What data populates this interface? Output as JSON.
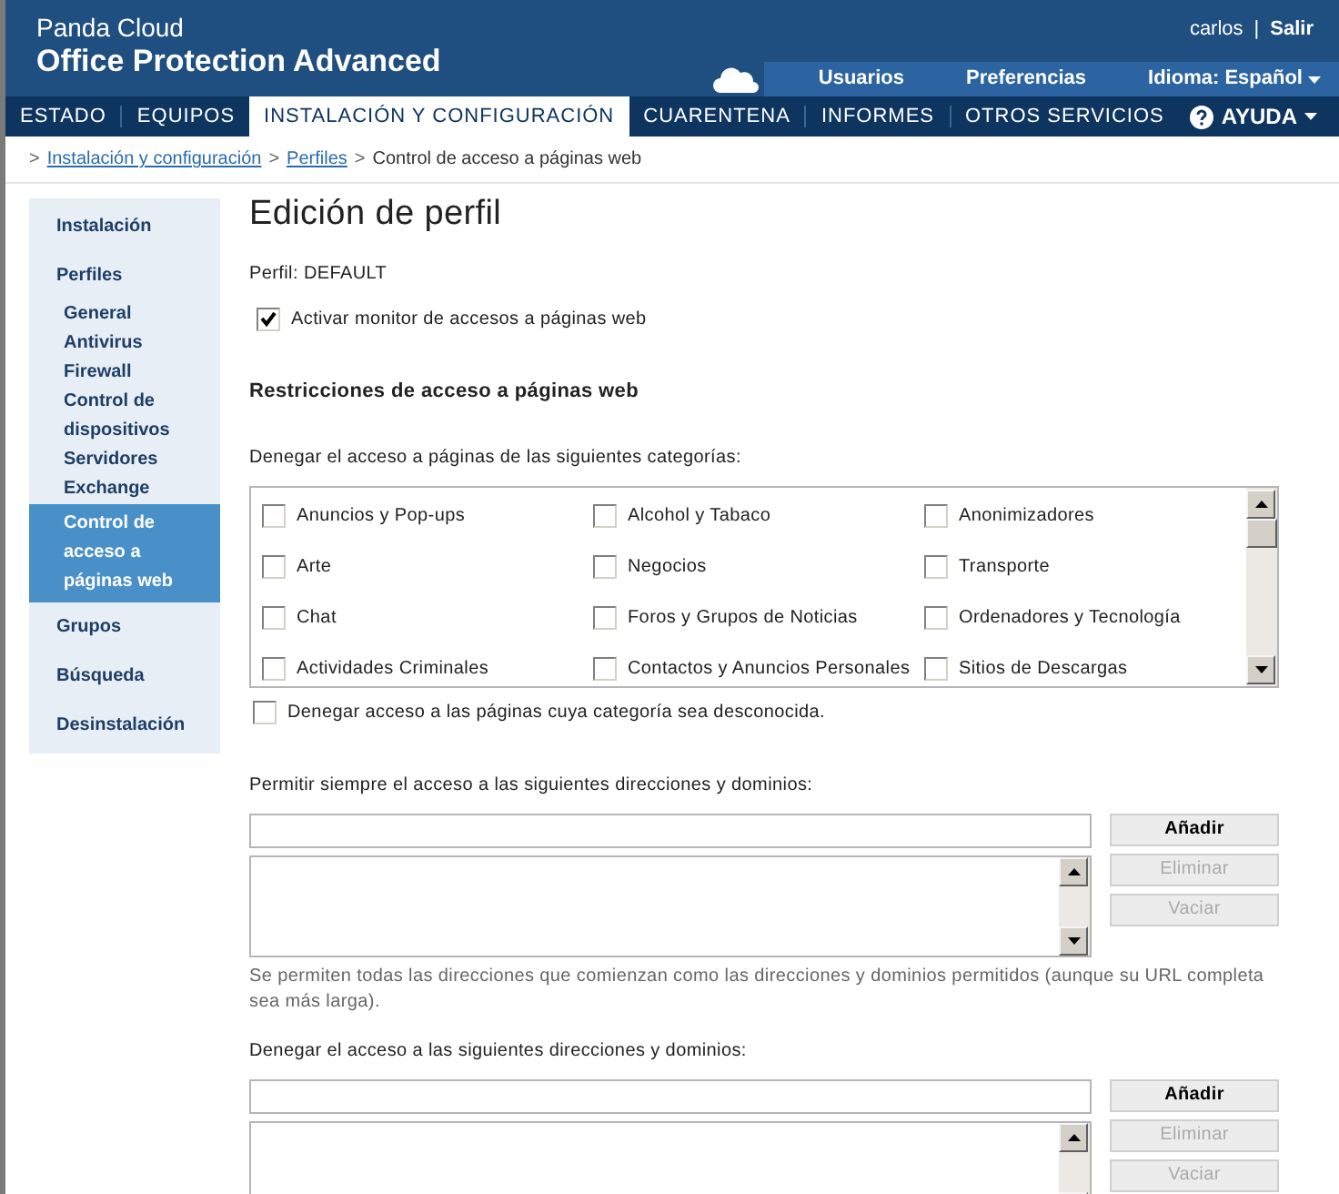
{
  "header": {
    "brand_top": "Panda Cloud",
    "brand_main": "Office Protection Advanced",
    "user": "carlos",
    "separator": "|",
    "logout": "Salir",
    "links": [
      "Usuarios",
      "Preferencias"
    ],
    "language": "Idioma: Español"
  },
  "nav": {
    "tabs": [
      {
        "label": "ESTADO",
        "selected": false
      },
      {
        "label": "EQUIPOS",
        "selected": false
      },
      {
        "label": "INSTALACIÓN Y CONFIGURACIÓN",
        "selected": true
      },
      {
        "label": "CUARENTENA",
        "selected": false
      },
      {
        "label": "INFORMES",
        "selected": false
      },
      {
        "label": "OTROS SERVICIOS",
        "selected": false
      }
    ],
    "help": "AYUDA"
  },
  "breadcrumb": [
    {
      "separator": ">",
      "label": "Instalación y configuración",
      "link": true
    },
    {
      "separator": ">",
      "label": "Perfiles",
      "link": true
    },
    {
      "separator": ">",
      "label": "Control de acceso a páginas web",
      "link": false
    }
  ],
  "sidebar": {
    "items": [
      {
        "label": "Instalación",
        "selected": false
      },
      {
        "label": "Perfiles",
        "selected": false,
        "children": [
          {
            "label": "General",
            "selected": false
          },
          {
            "label": "Antivirus",
            "selected": false
          },
          {
            "label": "Firewall",
            "selected": false
          },
          {
            "label": "Control de dispositivos",
            "selected": false
          },
          {
            "label": "Servidores Exchange",
            "selected": false
          },
          {
            "label": "Control de acceso a páginas web",
            "selected": true
          }
        ]
      },
      {
        "label": "Grupos",
        "selected": false
      },
      {
        "label": "Búsqueda",
        "selected": false
      },
      {
        "label": "Desinstalación",
        "selected": false
      }
    ]
  },
  "page": {
    "title": "Edición de perfil",
    "profile": "Perfil: DEFAULT",
    "monitor": {
      "label": "Activar monitor de accesos a páginas web",
      "checked": true
    },
    "section_title": "Restricciones de acceso a páginas web",
    "categories_label": "Denegar el acceso a páginas de las siguientes categorías:",
    "categories": [
      {
        "label": "Anuncios y Pop-ups",
        "checked": false
      },
      {
        "label": "Alcohol y Tabaco",
        "checked": false
      },
      {
        "label": "Anonimizadores",
        "checked": false
      },
      {
        "label": "Arte",
        "checked": false
      },
      {
        "label": "Negocios",
        "checked": false
      },
      {
        "label": "Transporte",
        "checked": false
      },
      {
        "label": "Chat",
        "checked": false
      },
      {
        "label": "Foros y Grupos de Noticias",
        "checked": false
      },
      {
        "label": "Ordenadores y Tecnología",
        "checked": false
      },
      {
        "label": "Actividades Criminales",
        "checked": false
      },
      {
        "label": "Contactos y Anuncios Personales",
        "checked": false
      },
      {
        "label": "Sitios de Descargas",
        "checked": false
      }
    ],
    "unknown": {
      "label": "Denegar acceso a las páginas cuya categoría sea desconocida.",
      "checked": false
    },
    "lists": [
      {
        "label": "Permitir siempre el acceso a las siguientes direcciones y dominios:",
        "buttons": [
          {
            "label": "Añadir",
            "disabled": false
          },
          {
            "label": "Eliminar",
            "disabled": true
          },
          {
            "label": "Vaciar",
            "disabled": true
          }
        ],
        "note": "Se permiten todas las direcciones que comienzan como las direcciones y dominios permitidos (aunque su URL completa sea más larga)."
      },
      {
        "label": "Denegar el acceso a las siguientes direcciones y dominios:",
        "buttons": [
          {
            "label": "Añadir",
            "disabled": false
          },
          {
            "label": "Eliminar",
            "disabled": true
          },
          {
            "label": "Vaciar",
            "disabled": true
          }
        ]
      }
    ]
  }
}
